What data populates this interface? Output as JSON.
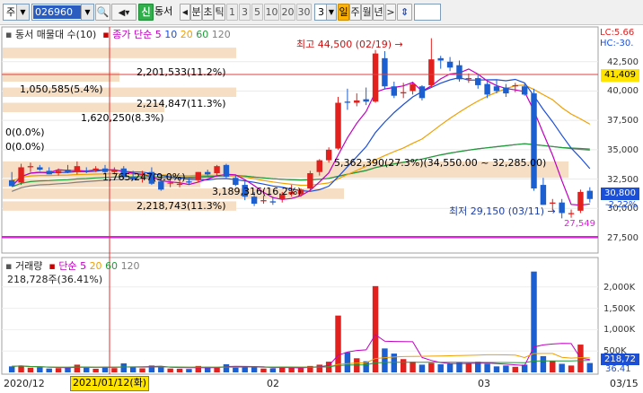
{
  "toolbar": {
    "market_label": "주",
    "code_value": "026960",
    "name_value": "동서",
    "credit_icon_text": "신",
    "period_buttons": [
      "분",
      "초",
      "틱",
      "1",
      "3",
      "5",
      "10",
      "20",
      "30"
    ],
    "period_count": "3",
    "period_units": [
      "일",
      "주",
      "월",
      "년"
    ],
    "selected_unit": "일",
    "arrows": [
      "◀",
      ">",
      "⇕"
    ]
  },
  "price_pane": {
    "legend": {
      "indicator": "동서 매물대 수(10)",
      "ma_label": "종가 단순",
      "ma_periods": [
        "5",
        "10",
        "20",
        "60",
        "120"
      ],
      "ma_colors": [
        "#c000c0",
        "#1c4fd8",
        "#f0a000",
        "#1f9a3a",
        "#808080"
      ]
    },
    "top_right_values": {
      "lc": "LC:5.66",
      "hc": "HC:-30."
    },
    "price_axis": [
      "42,500",
      "40,000",
      "37,500",
      "35,000",
      "32,500",
      "30,000",
      "27,500"
    ],
    "price_badges": {
      "high": "41,409",
      "current": "30,800",
      "pct": "-2.22%",
      "low_line": "27,549"
    },
    "volume_profile_labels": [
      "2,201,533(11.2%)",
      "1,050,585(5.4%)",
      "2,214,847(11.3%)",
      "1,620,250(8.3%)",
      "0(0.0%)",
      "0(0.0%)",
      "5,362,390(27.3%)(34,550.00 ~ 32,285.00)",
      "1,765,247(9.0%)",
      "3,189,316(16.2%)",
      "2,218,743(11.3%)"
    ],
    "max_annotation": "최고 44,500 (02/19)",
    "min_annotation": "최저 29,150 (03/11)"
  },
  "volume_pane": {
    "legend": {
      "title": "거래량",
      "ma_label": "단순",
      "ma_periods": [
        "5",
        "20",
        "60",
        "120"
      ],
      "ma_colors": [
        "#c000c0",
        "#f0a000",
        "#1f9a3a",
        "#808080"
      ]
    },
    "info": "218,728주(36.41%)",
    "axis": [
      "2,000K",
      "1,500K",
      "1,000K",
      "500K"
    ],
    "badges": {
      "volume": "218,72",
      "pct": "36.41"
    }
  },
  "date_axis": {
    "labels": [
      "2020/12",
      "02",
      "03",
      "03/15"
    ],
    "cursor_date": "2021/01/12(화)"
  },
  "colors": {
    "up": "#e0211e",
    "down": "#1c5fd0",
    "ma5": "#c000c0",
    "ma10": "#1c4fd8",
    "ma20": "#f0a000",
    "ma60": "#1f9a3a",
    "ma120": "#808080",
    "profile": "#f6dec5",
    "support_line": "#e020e0",
    "high_line": "#e04040",
    "cursor": "#e03030"
  },
  "chart_data": {
    "type": "candlestick",
    "y_range": [
      26500,
      44700
    ],
    "candles": [
      {
        "o": 32400,
        "h": 33100,
        "l": 31900,
        "c": 31900
      },
      {
        "o": 32200,
        "h": 33800,
        "l": 32000,
        "c": 33500
      },
      {
        "o": 33500,
        "h": 33900,
        "l": 33100,
        "c": 33600
      },
      {
        "o": 33500,
        "h": 33700,
        "l": 33200,
        "c": 33300
      },
      {
        "o": 33200,
        "h": 33500,
        "l": 32900,
        "c": 32900
      },
      {
        "o": 33000,
        "h": 33400,
        "l": 32800,
        "c": 33200
      },
      {
        "o": 33300,
        "h": 33700,
        "l": 33000,
        "c": 33100
      },
      {
        "o": 33100,
        "h": 34000,
        "l": 32900,
        "c": 33600
      },
      {
        "o": 33200,
        "h": 33500,
        "l": 33000,
        "c": 33100
      },
      {
        "o": 33300,
        "h": 33600,
        "l": 33100,
        "c": 33400
      },
      {
        "o": 33400,
        "h": 33700,
        "l": 33000,
        "c": 33100
      },
      {
        "o": 33100,
        "h": 33500,
        "l": 32900,
        "c": 33300
      },
      {
        "o": 33400,
        "h": 33600,
        "l": 32500,
        "c": 32700
      },
      {
        "o": 32700,
        "h": 33200,
        "l": 32400,
        "c": 32500
      },
      {
        "o": 32900,
        "h": 33200,
        "l": 32200,
        "c": 32900
      },
      {
        "o": 33100,
        "h": 33500,
        "l": 32000,
        "c": 32100
      },
      {
        "o": 32300,
        "h": 32600,
        "l": 31500,
        "c": 31600
      },
      {
        "o": 32200,
        "h": 32500,
        "l": 31800,
        "c": 32200
      },
      {
        "o": 32000,
        "h": 32400,
        "l": 31800,
        "c": 32100
      },
      {
        "o": 32300,
        "h": 32600,
        "l": 32000,
        "c": 32200
      },
      {
        "o": 32400,
        "h": 33100,
        "l": 32200,
        "c": 33100
      },
      {
        "o": 33100,
        "h": 33300,
        "l": 32800,
        "c": 32900
      },
      {
        "o": 33000,
        "h": 33700,
        "l": 32800,
        "c": 33600
      },
      {
        "o": 33700,
        "h": 33800,
        "l": 32600,
        "c": 32700
      },
      {
        "o": 32600,
        "h": 32800,
        "l": 31900,
        "c": 32000
      },
      {
        "o": 32000,
        "h": 32300,
        "l": 30700,
        "c": 31000
      },
      {
        "o": 31000,
        "h": 31400,
        "l": 30200,
        "c": 30400
      },
      {
        "o": 30600,
        "h": 31100,
        "l": 30400,
        "c": 30700
      },
      {
        "o": 30600,
        "h": 31000,
        "l": 30300,
        "c": 30500
      },
      {
        "o": 30800,
        "h": 31400,
        "l": 30500,
        "c": 31200
      },
      {
        "o": 31200,
        "h": 32000,
        "l": 31000,
        "c": 31400
      },
      {
        "o": 31200,
        "h": 31700,
        "l": 31000,
        "c": 31600
      },
      {
        "o": 31700,
        "h": 33200,
        "l": 31500,
        "c": 33000
      },
      {
        "o": 33100,
        "h": 34200,
        "l": 32800,
        "c": 34100
      },
      {
        "o": 34100,
        "h": 35200,
        "l": 33900,
        "c": 35000
      },
      {
        "o": 35100,
        "h": 39500,
        "l": 35000,
        "c": 39000
      },
      {
        "o": 39100,
        "h": 40200,
        "l": 38400,
        "c": 39000
      },
      {
        "o": 39000,
        "h": 39800,
        "l": 38700,
        "c": 39200
      },
      {
        "o": 39300,
        "h": 40300,
        "l": 38800,
        "c": 39100
      },
      {
        "o": 39100,
        "h": 43500,
        "l": 39000,
        "c": 43200
      },
      {
        "o": 42800,
        "h": 43400,
        "l": 40200,
        "c": 40400
      },
      {
        "o": 40400,
        "h": 40800,
        "l": 39400,
        "c": 39600
      },
      {
        "o": 39800,
        "h": 40700,
        "l": 39400,
        "c": 39900
      },
      {
        "o": 40000,
        "h": 40800,
        "l": 39700,
        "c": 40600
      },
      {
        "o": 40400,
        "h": 40500,
        "l": 39200,
        "c": 39400
      },
      {
        "o": 40500,
        "h": 44500,
        "l": 40300,
        "c": 42700
      },
      {
        "o": 42800,
        "h": 43000,
        "l": 41900,
        "c": 42600
      },
      {
        "o": 42500,
        "h": 42900,
        "l": 41700,
        "c": 42000
      },
      {
        "o": 42200,
        "h": 42600,
        "l": 40800,
        "c": 41000
      },
      {
        "o": 41100,
        "h": 41500,
        "l": 40700,
        "c": 41100
      },
      {
        "o": 41100,
        "h": 41500,
        "l": 40200,
        "c": 40500
      },
      {
        "o": 40600,
        "h": 40800,
        "l": 39400,
        "c": 39700
      },
      {
        "o": 40400,
        "h": 41000,
        "l": 39800,
        "c": 40000
      },
      {
        "o": 40300,
        "h": 40600,
        "l": 39500,
        "c": 39800
      },
      {
        "o": 40400,
        "h": 40700,
        "l": 39900,
        "c": 40500
      },
      {
        "o": 40400,
        "h": 40600,
        "l": 39600,
        "c": 39700
      },
      {
        "o": 39800,
        "h": 40200,
        "l": 31500,
        "c": 31700
      },
      {
        "o": 32000,
        "h": 32600,
        "l": 30300,
        "c": 30300
      },
      {
        "o": 30400,
        "h": 30800,
        "l": 29800,
        "c": 30500
      },
      {
        "o": 30500,
        "h": 30800,
        "l": 29150,
        "c": 29600
      },
      {
        "o": 29500,
        "h": 29900,
        "l": 29200,
        "c": 29600
      },
      {
        "o": 29800,
        "h": 31600,
        "l": 29600,
        "c": 31400
      },
      {
        "o": 31500,
        "h": 31800,
        "l": 30500,
        "c": 30800
      }
    ],
    "volumes": [
      140,
      160,
      110,
      120,
      90,
      100,
      115,
      180,
      110,
      85,
      130,
      100,
      210,
      120,
      95,
      160,
      140,
      90,
      85,
      80,
      150,
      130,
      120,
      190,
      110,
      140,
      120,
      90,
      95,
      130,
      115,
      100,
      150,
      180,
      250,
      1330,
      470,
      330,
      260,
      2020,
      560,
      440,
      310,
      250,
      180,
      220,
      190,
      200,
      230,
      210,
      250,
      200,
      140,
      160,
      130,
      180,
      2360,
      380,
      270,
      200,
      160,
      650,
      219
    ]
  }
}
